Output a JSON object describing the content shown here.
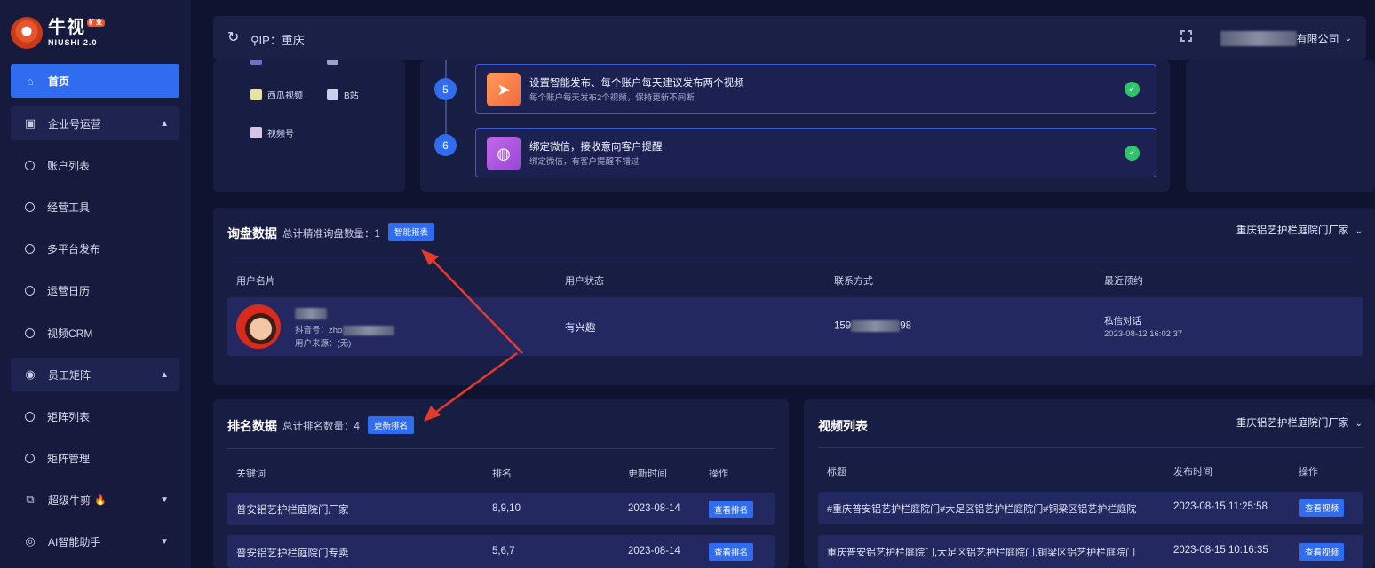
{
  "brand": {
    "name": "牛视",
    "badge": "矿业",
    "sub": "NIUSHI 2.0"
  },
  "sidebar": {
    "items": [
      {
        "label": "首页",
        "icon": "home-icon"
      },
      {
        "label": "企业号运营",
        "icon": "chart-icon"
      },
      {
        "label": "账户列表"
      },
      {
        "label": "经营工具"
      },
      {
        "label": "多平台发布"
      },
      {
        "label": "运营日历"
      },
      {
        "label": "视频CRM"
      },
      {
        "label": "员工矩阵",
        "icon": "broadcast-icon"
      },
      {
        "label": "矩阵列表"
      },
      {
        "label": "矩阵管理"
      },
      {
        "label": "超级牛剪",
        "icon": "crop-icon"
      },
      {
        "label": "AI智能助手",
        "icon": "ai-icon"
      }
    ]
  },
  "header": {
    "ip_label": "IP：重庆",
    "company": "有限公司"
  },
  "platforms": [
    {
      "label": "西瓜视频",
      "color": "#e9dfa8"
    },
    {
      "label": "B站",
      "color": "#c8d0ee"
    },
    {
      "label": "视频号",
      "color": "#d3c6e8"
    }
  ],
  "steps": [
    {
      "num": "5",
      "title": "设置智能发布、每个账户每天建议发布两个视频",
      "sub": "每个账户每天发布2个视频，保持更新不间断"
    },
    {
      "num": "6",
      "title": "绑定微信，接收意向客户提醒",
      "sub": "绑定微信，有客户提醒不错过"
    }
  ],
  "inquiry": {
    "title": "询盘数据",
    "count_label": "总计精准询盘数量：1",
    "report_button": "智能报表",
    "dropdown": "重庆铝艺护栏庭院门厂家",
    "columns": [
      "用户名片",
      "用户状态",
      "联系方式",
      "最近预约"
    ],
    "row": {
      "douyin": "抖音号：zho",
      "source": "用户来源：(无)",
      "status": "有兴趣",
      "phone_pre": "159",
      "phone_post": "98",
      "appt_type": "私信对话",
      "appt_time": "2023-08-12 16:02:37"
    }
  },
  "ranking": {
    "title": "排名数据",
    "count_label": "总计排名数量：4",
    "update_button": "更新排名",
    "columns": [
      "关键词",
      "排名",
      "更新时间",
      "操作"
    ],
    "rows": [
      {
        "keyword": "普安铝艺护栏庭院门厂家",
        "rank": "8,9,10",
        "time": "2023-08-14",
        "action": "查看排名"
      },
      {
        "keyword": "普安铝艺护栏庭院门专卖",
        "rank": "5,6,7",
        "time": "2023-08-14",
        "action": "查看排名"
      }
    ]
  },
  "videos": {
    "title": "视频列表",
    "dropdown": "重庆铝艺护栏庭院门厂家",
    "columns": [
      "标题",
      "发布时间",
      "操作"
    ],
    "rows": [
      {
        "title": "#重庆普安铝艺护栏庭院门#大足区铝艺护栏庭院门#铜梁区铝艺护栏庭院",
        "time": "2023-08-15 11:25:58",
        "action": "查看视频"
      },
      {
        "title": "重庆普安铝艺护栏庭院门,大足区铝艺护栏庭院门,铜梁区铝艺护栏庭院门",
        "time": "2023-08-15 10:16:35",
        "action": "查看视频"
      }
    ]
  },
  "colors": {
    "accent": "#2f6cf0",
    "annotation": "#e53a2c",
    "success": "#2fc46c"
  }
}
